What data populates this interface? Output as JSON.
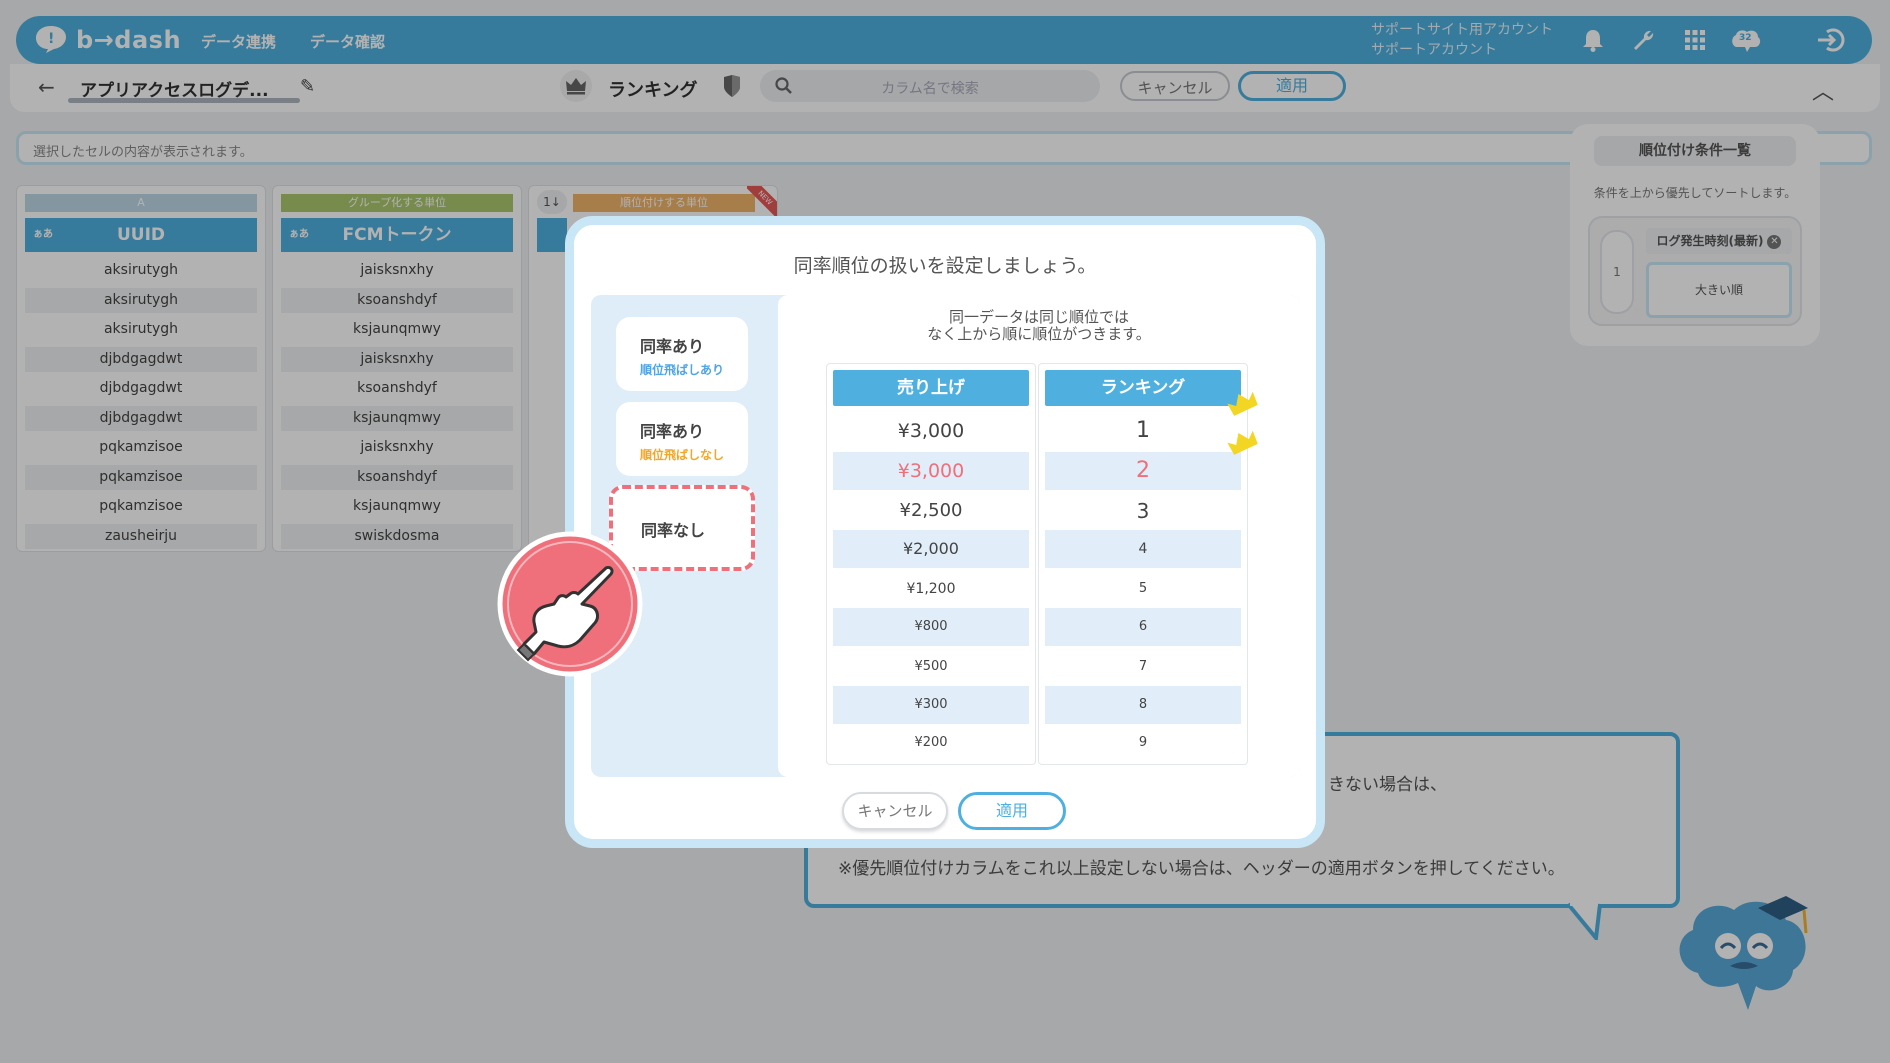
{
  "header": {
    "logo_text": "b→dash",
    "nav": [
      "データ連携",
      "データ確認"
    ],
    "account_line1": "サポートサイト用アカウント",
    "account_line2": "サポートアカウント",
    "brain_badge": "32"
  },
  "subbar": {
    "report_title": "アプリアクセスログデ...",
    "rank_label": "ランキング",
    "search_placeholder": "カラム名で検索",
    "cancel_label": "キャンセル",
    "apply_label": "適用"
  },
  "cell_bar": {
    "placeholder": "選択したセルの内容が表示されます。"
  },
  "columns": [
    {
      "tag": "A",
      "header": "UUID",
      "type_badge": "ぁあ",
      "rows": [
        "aksirutygh",
        "aksirutygh",
        "aksirutygh",
        "djbdgagdwt",
        "djbdgagdwt",
        "djbdgagdwt",
        "pqkamzisoe",
        "pqkamzisoe",
        "pqkamzisoe",
        "zausheirju"
      ]
    },
    {
      "tag": "グループ化する単位",
      "header": "FCMトークン",
      "type_badge": "ぁあ",
      "rows": [
        "jaisksnxhy",
        "ksoanshdyf",
        "ksjaunqmwy",
        "jaisksnxhy",
        "ksoanshdyf",
        "ksjaunqmwy",
        "jaisksnxhy",
        "ksoanshdyf",
        "ksjaunqmwy",
        "swiskdosma"
      ]
    },
    {
      "tag": "順位付けする単位",
      "sort_icon": "1↓",
      "new_badge": "NEW"
    }
  ],
  "conditions_panel": {
    "title": "順位付け条件一覧",
    "description": "条件を上から優先してソートします。",
    "items": [
      {
        "index": "1",
        "field": "ログ発生時刻(最新)",
        "order": "大きい順"
      }
    ]
  },
  "bubble": {
    "line1": "きない場合は、",
    "line2": "※優先順位付けカラムをこれ以上設定しない場合は、ヘッダーの適用ボタンを押してください。"
  },
  "modal": {
    "title": "同率順位の扱いを設定しましょう。",
    "options": [
      {
        "main": "同率あり",
        "sub": "順位飛ばしあり",
        "sub_color": "#4fa5e6"
      },
      {
        "main": "同率あり",
        "sub": "順位飛ばしなし",
        "sub_color": "#f5a623"
      },
      {
        "main": "同率なし",
        "sub": "",
        "selected": true
      }
    ],
    "description_line1": "同一データは同じ順位では",
    "description_line2": "なく上から順に順位がつきます。",
    "table": {
      "col1_header": "売り上げ",
      "col2_header": "ランキング",
      "rows": [
        {
          "sales": "¥3,000",
          "rank": "1",
          "highlight": false
        },
        {
          "sales": "¥3,000",
          "rank": "2",
          "highlight": true
        },
        {
          "sales": "¥2,500",
          "rank": "3",
          "highlight": false
        },
        {
          "sales": "¥2,000",
          "rank": "4",
          "highlight": false
        },
        {
          "sales": "¥1,200",
          "rank": "5",
          "highlight": false
        },
        {
          "sales": "¥800",
          "rank": "6",
          "highlight": false
        },
        {
          "sales": "¥500",
          "rank": "7",
          "highlight": false
        },
        {
          "sales": "¥300",
          "rank": "8",
          "highlight": false
        },
        {
          "sales": "¥200",
          "rank": "9",
          "highlight": false
        }
      ]
    },
    "cancel_label": "キャンセル",
    "apply_label": "適用"
  },
  "colors": {
    "brand_blue": "#4fb0e0",
    "highlight_red": "#ef6f7a",
    "tag_green": "#a9c86d",
    "tag_orange": "#f0b36a",
    "crown_yellow": "#f3d523"
  }
}
